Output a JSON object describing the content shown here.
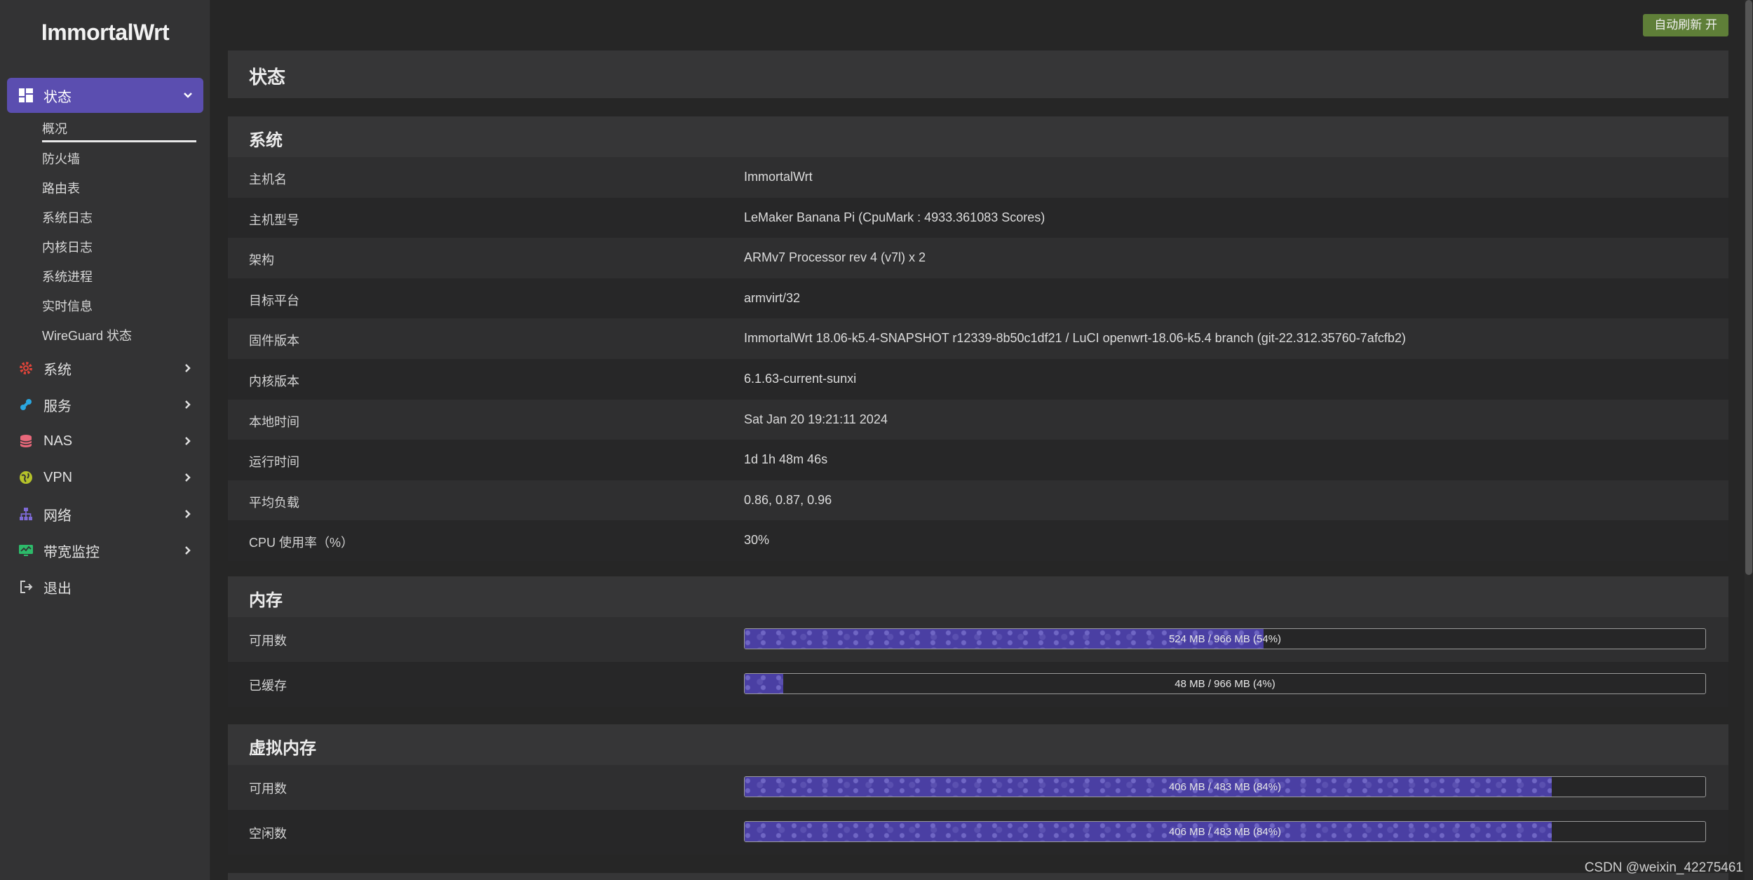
{
  "app": {
    "logo": "ImmortalWrt",
    "auto_refresh": "自动刷新 开"
  },
  "sidebar": {
    "status": {
      "label": "状态"
    },
    "status_sub": [
      "概况",
      "防火墙",
      "路由表",
      "系统日志",
      "内核日志",
      "系统进程",
      "实时信息",
      "WireGuard 状态"
    ],
    "items": [
      {
        "label": "系统",
        "icon": "gear-icon",
        "color": "#e0443a"
      },
      {
        "label": "服务",
        "icon": "puzzle-icon",
        "color": "#2aa7e0"
      },
      {
        "label": "NAS",
        "icon": "database-icon",
        "color": "#e8687a"
      },
      {
        "label": "VPN",
        "icon": "globe-icon",
        "color": "#b5c22a"
      },
      {
        "label": "网络",
        "icon": "network-icon",
        "color": "#7e6ad6"
      },
      {
        "label": "带宽监控",
        "icon": "monitor-icon",
        "color": "#2dbb6a"
      },
      {
        "label": "退出",
        "icon": "logout-icon",
        "color": "#d0d0d0"
      }
    ]
  },
  "page": {
    "title": "状态"
  },
  "system": {
    "title": "系统",
    "rows": [
      {
        "key": "主机名",
        "value": "ImmortalWrt"
      },
      {
        "key": "主机型号",
        "value": "LeMaker Banana Pi (CpuMark : 4933.361083 Scores)"
      },
      {
        "key": "架构",
        "value": "ARMv7 Processor rev 4 (v7l) x 2"
      },
      {
        "key": "目标平台",
        "value": "armvirt/32"
      },
      {
        "key": "固件版本",
        "value": "ImmortalWrt 18.06-k5.4-SNAPSHOT r12339-8b50c1df21 / LuCI openwrt-18.06-k5.4 branch (git-22.312.35760-7afcfb2)"
      },
      {
        "key": "内核版本",
        "value": "6.1.63-current-sunxi"
      },
      {
        "key": "本地时间",
        "value": "Sat Jan 20 19:21:11 2024"
      },
      {
        "key": "运行时间",
        "value": "1d 1h 48m 46s"
      },
      {
        "key": "平均负载",
        "value": "0.86, 0.87, 0.96"
      },
      {
        "key": "CPU 使用率（%）",
        "value": "30%"
      }
    ]
  },
  "memory": {
    "title": "内存",
    "rows": [
      {
        "key": "可用数",
        "text": "524 MB / 966 MB (54%)",
        "percent": 54
      },
      {
        "key": "已缓存",
        "text": "48 MB / 966 MB (4%)",
        "percent": 4
      }
    ]
  },
  "swap": {
    "title": "虚拟内存",
    "rows": [
      {
        "key": "可用数",
        "text": "406 MB / 483 MB (84%)",
        "percent": 84
      },
      {
        "key": "空闲数",
        "text": "406 MB / 483 MB (84%)",
        "percent": 84
      }
    ]
  },
  "watermark": "CSDN @weixin_42275461",
  "colors": {
    "accent": "#5b4eb0",
    "refresh_button": "#5f7f38",
    "progress": "#4a3fa3"
  }
}
